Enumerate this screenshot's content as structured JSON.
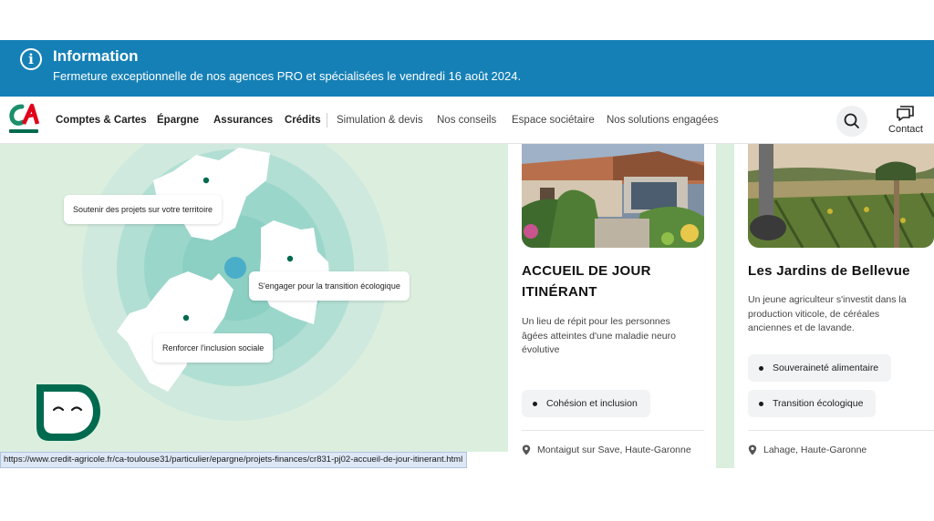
{
  "info": {
    "title": "Information",
    "message": "Fermeture exceptionnelle de nos agences PRO et spécialisées le vendredi 16 août 2024."
  },
  "header": {
    "nav_primary": [
      "Comptes & Cartes",
      "Épargne",
      "Assurances",
      "Crédits"
    ],
    "nav_secondary": [
      "Simulation & devis",
      "Nos conseils",
      "Espace sociétaire",
      "Nos solutions engagées"
    ],
    "contact_label": "Contact"
  },
  "map": {
    "labels": [
      "Soutenir des projets sur votre territoire",
      "S'engager pour la transition écologique",
      "Renforcer l'inclusion sociale"
    ]
  },
  "cards": [
    {
      "title_line1": "ACCUEIL DE JOUR",
      "title_line2": "ITINÉRANT",
      "desc_lines": [
        "Un lieu de répit pour les personnes",
        "âgées atteintes d'une maladie neuro",
        "évolutive"
      ],
      "tags": [
        "Cohésion et inclusion"
      ],
      "location": "Montaigut sur Save, Haute-Garonne"
    },
    {
      "title_line1": "Les Jardins de Bellevue",
      "desc_lines": [
        "Un jeune agriculteur s'investit dans la",
        "production viticole, de céréales",
        "anciennes et de lavande."
      ],
      "tags": [
        "Souveraineté alimentaire",
        "Transition écologique"
      ],
      "location": "Lahage, Haute-Garonne"
    }
  ],
  "status_url": "https://www.credit-agricole.fr/ca-toulouse31/particulier/epargne/projets-finances/cr831-pj02-accueil-de-jour-itinerant.html",
  "colors": {
    "banner": "#1580b6",
    "brand_green": "#006a4e",
    "brand_red": "#e2001a",
    "map_bg": "#dcefdf",
    "map_circle": "#7fc7c0"
  }
}
